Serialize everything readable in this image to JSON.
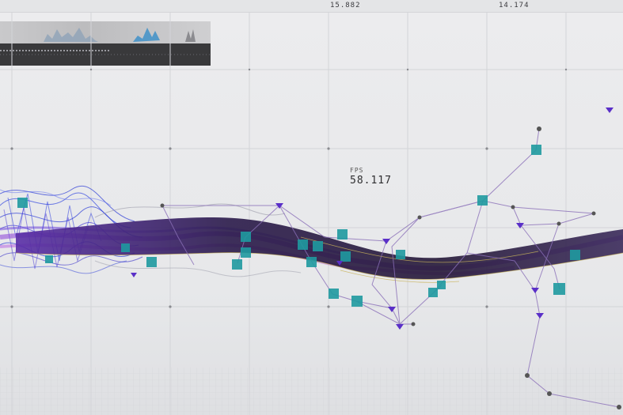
{
  "hud": {
    "readout_a": "15.882",
    "readout_b": "14.174",
    "fps_label": "FPS",
    "fps_value": "58.117"
  },
  "colors": {
    "background": "#e9eaec",
    "grid": "#cfd0d4",
    "wave_blue": "#2b3bd6",
    "wave_violet": "#8a3fd8",
    "ribbon_dark": "#2a1a4a",
    "ribbon_gold": "#c9b35a",
    "node_square": "#1f9aa0",
    "node_triangle": "#5a2fc8",
    "node_dot": "#555555",
    "link_line": "#8a6fb8"
  },
  "icons": {
    "square_node": "teal-square-node-icon",
    "triangle_node": "violet-triangle-node-icon",
    "dot_node": "gray-dot-node-icon"
  }
}
